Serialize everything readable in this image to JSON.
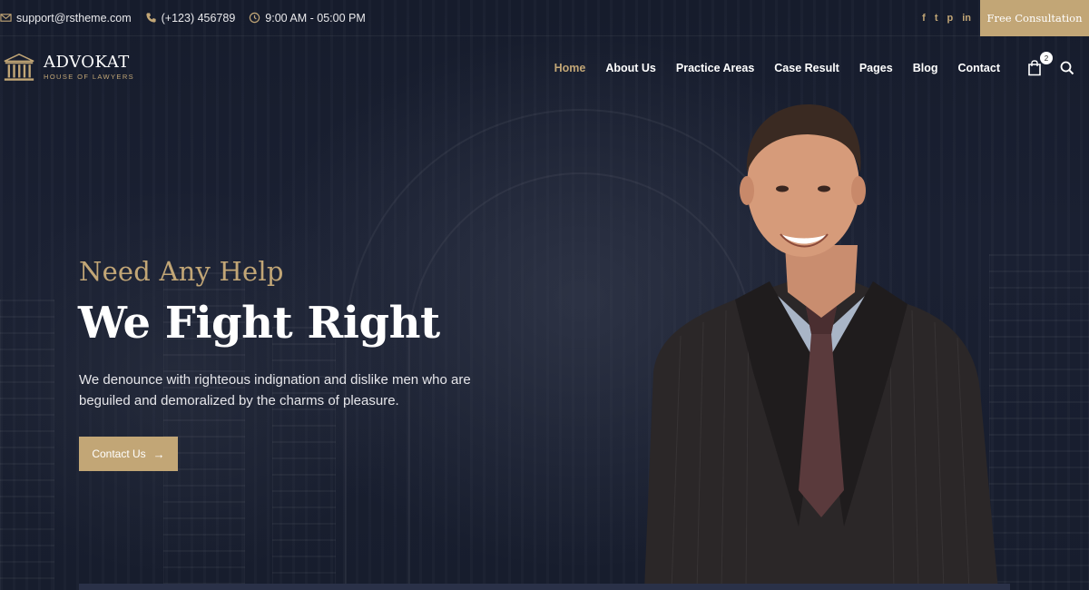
{
  "topbar": {
    "email": "support@rstheme.com",
    "phone": "(+123) 456789",
    "hours": "9:00 AM - 05:00 PM",
    "social": [
      "facebook-icon",
      "twitter-icon",
      "pinterest-icon",
      "linkedin-icon"
    ],
    "social_glyphs": [
      "f",
      "t",
      "p",
      "in"
    ],
    "cta_label": "Free Consultation"
  },
  "logo": {
    "name": "ADVOKAT",
    "tagline": "HOUSE OF LAWYERS"
  },
  "nav": {
    "items": [
      "Home",
      "About Us",
      "Practice Areas",
      "Case Result",
      "Pages",
      "Blog",
      "Contact"
    ],
    "active": "Home",
    "cart_count": "2"
  },
  "hero": {
    "pretitle": "Need Any Help",
    "title": "We Fight Right",
    "description": "We denounce with righteous indignation and dislike men who are beguiled and demoralized by the charms of pleasure.",
    "button_label": "Contact Us"
  },
  "colors": {
    "accent": "#c2a676",
    "background": "#141a2a"
  }
}
